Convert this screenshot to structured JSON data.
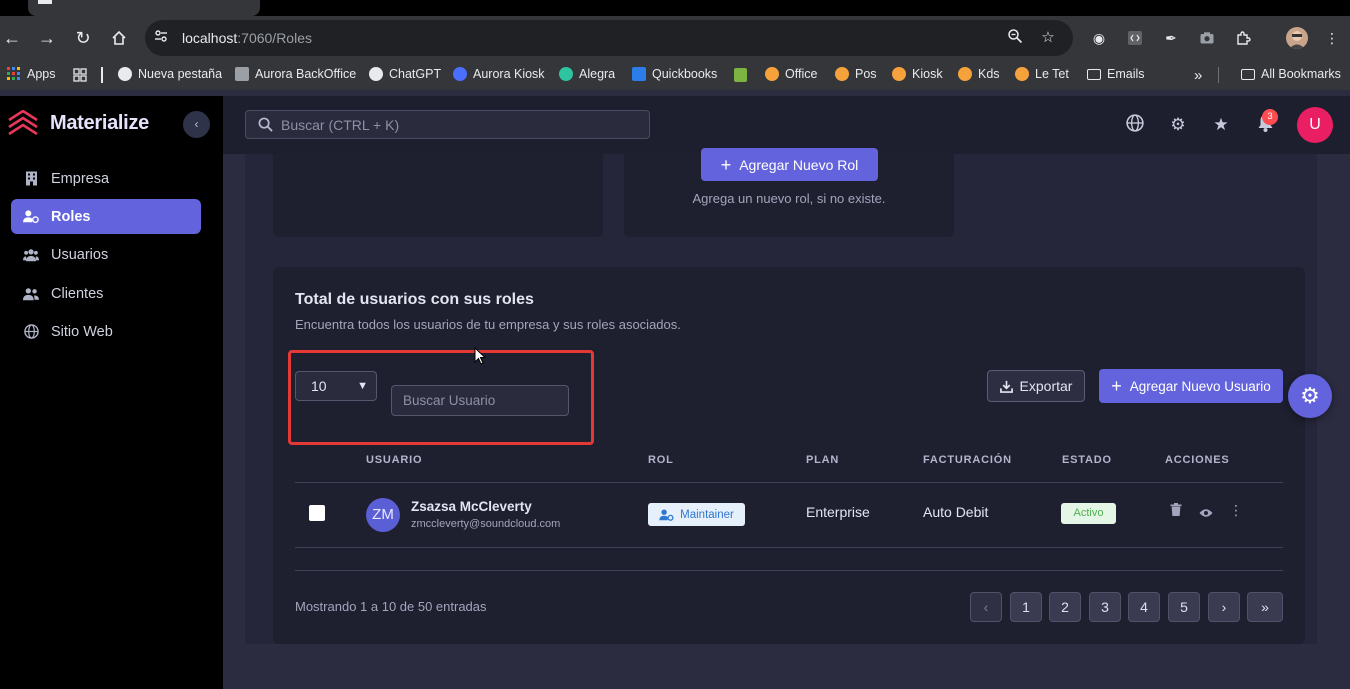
{
  "browser": {
    "url_host": "localhost",
    "url_path": ":7060/Roles",
    "bookmarks": [
      {
        "label": "Apps",
        "color": "#4285f4"
      },
      {
        "label": "Nueva pestaña",
        "color": "#e8eaed"
      },
      {
        "label": "Aurora BackOffice",
        "color": "#9aa0a6"
      },
      {
        "label": "ChatGPT",
        "color": "#e8eaed"
      },
      {
        "label": "Aurora Kiosk",
        "color": "#4a6fff"
      },
      {
        "label": "Alegra",
        "color": "#2ec4a0"
      },
      {
        "label": "Quickbooks",
        "color": "#2b7de9"
      },
      {
        "label": "Office",
        "color": "#f6a23c"
      },
      {
        "label": "Pos",
        "color": "#f6a23c"
      },
      {
        "label": "Kiosk",
        "color": "#f6a23c"
      },
      {
        "label": "Kds",
        "color": "#f6a23c"
      },
      {
        "label": "Le Tet",
        "color": "#f6a23c"
      },
      {
        "label": "Emails",
        "color": "folder"
      }
    ],
    "all_bookmarks": "All Bookmarks"
  },
  "app": {
    "brand": "Materialize",
    "search_placeholder": "Buscar (CTRL + K)",
    "notifications_count": "3",
    "avatar_initial": "U",
    "accent_color": "#6363dd"
  },
  "sidebar": {
    "items": [
      {
        "label": "Empresa",
        "icon": "building-icon"
      },
      {
        "label": "Roles",
        "icon": "user-cog-icon"
      },
      {
        "label": "Usuarios",
        "icon": "users-icon"
      },
      {
        "label": "Clientes",
        "icon": "users-icon"
      },
      {
        "label": "Sitio Web",
        "icon": "globe-icon"
      }
    ]
  },
  "add_role_card": {
    "button_label": "Agregar Nuevo Rol",
    "hint": "Agrega un nuevo rol, si no existe."
  },
  "users_card": {
    "title": "Total de usuarios con sus roles",
    "subtitle": "Encuentra todos los usuarios de tu empresa y sus roles asociados.",
    "page_size": "10",
    "search_placeholder": "Buscar Usuario",
    "export_label": "Exportar",
    "add_user_label": "Agregar Nuevo Usuario",
    "columns": [
      "USUARIO",
      "ROL",
      "PLAN",
      "FACTURACIÓN",
      "ESTADO",
      "ACCIONES"
    ],
    "rows": [
      {
        "initials": "ZM",
        "name": "Zsazsa McCleverty",
        "email": "zmccleverty@soundcloud.com",
        "role": "Maintainer",
        "plan": "Enterprise",
        "billing": "Auto Debit",
        "status": "Activo"
      }
    ],
    "footer_text": "Mostrando 1 a 10 de 50 entradas",
    "pages": [
      "1",
      "2",
      "3",
      "4",
      "5"
    ]
  }
}
